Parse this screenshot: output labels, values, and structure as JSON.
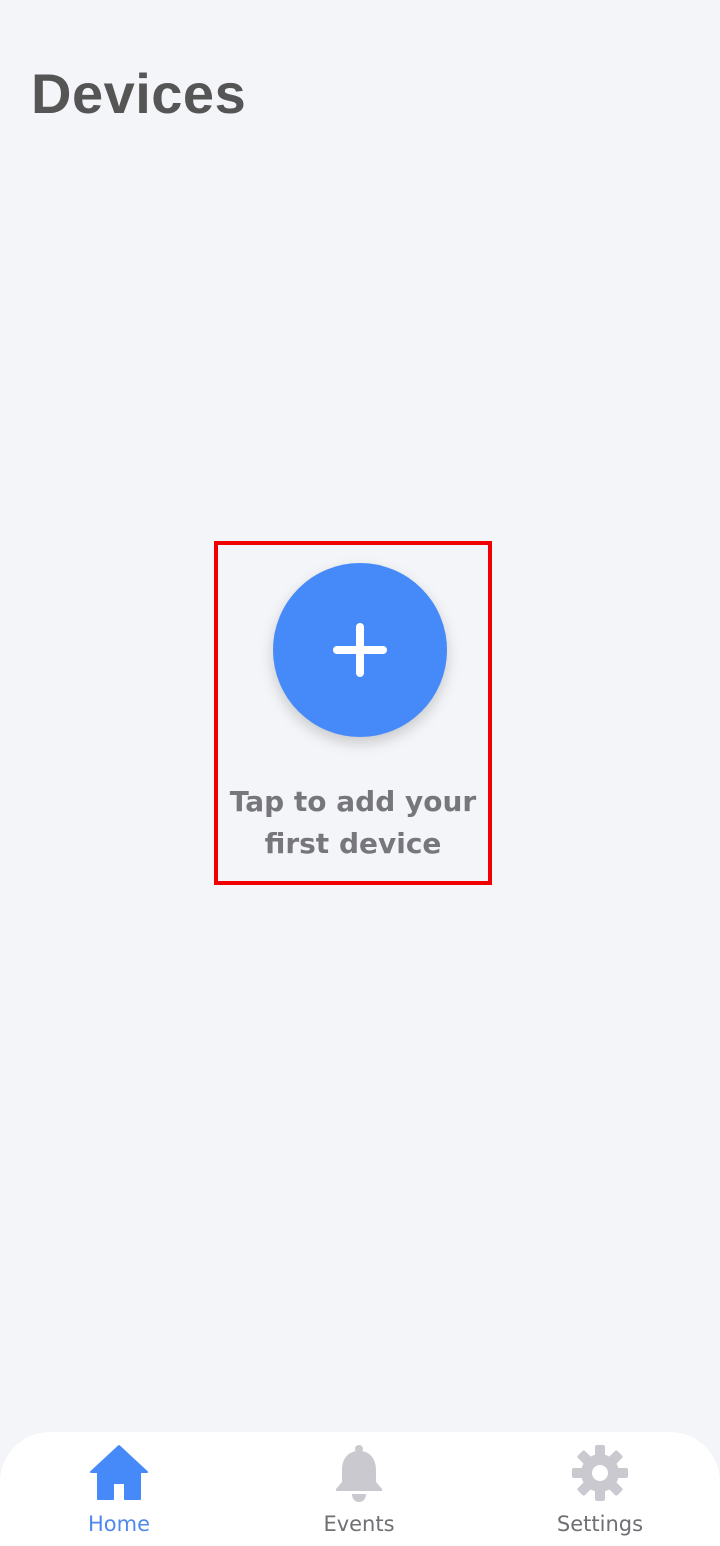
{
  "header": {
    "title": "Devices"
  },
  "empty_state": {
    "add_button_icon": "plus-icon",
    "hint": "Tap to add your\nfirst device"
  },
  "bottom_nav": {
    "items": [
      {
        "label": "Home",
        "icon": "home-icon",
        "active": true
      },
      {
        "label": "Events",
        "icon": "bell-icon",
        "active": false
      },
      {
        "label": "Settings",
        "icon": "gear-icon",
        "active": false
      }
    ]
  },
  "colors": {
    "background": "#f4f5f8",
    "accent": "#468af9",
    "active_nav": "#4f89ea",
    "inactive_icon": "#c9c9cf",
    "title_text": "#555555",
    "highlight": "#f00000"
  }
}
